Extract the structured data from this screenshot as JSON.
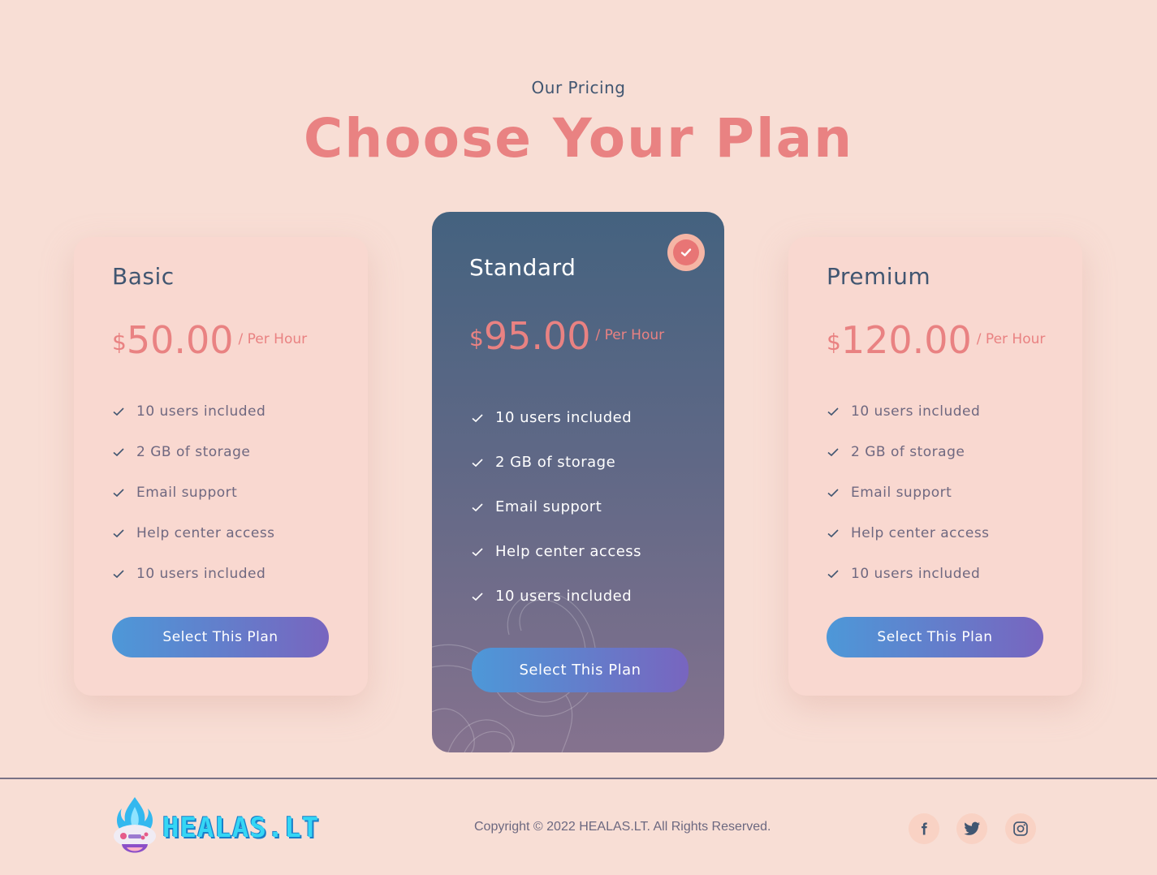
{
  "header": {
    "subtitle": "Our Pricing",
    "title": "Choose Your Plan"
  },
  "plans": [
    {
      "name": "Basic",
      "currency": "$",
      "amount": "50.00",
      "period": "/ Per Hour",
      "features": [
        "10 users included",
        "2 GB of storage",
        "Email support",
        "Help center access",
        "10 users included"
      ],
      "button_label": "Select This Plan"
    },
    {
      "name": "Standard",
      "currency": "$",
      "amount": "95.00",
      "period": "/ Per Hour",
      "features": [
        "10 users included",
        "2 GB of storage",
        "Email support",
        "Help center access",
        "10 users included"
      ],
      "button_label": "Select This Plan",
      "selected": true
    },
    {
      "name": "Premium",
      "currency": "$",
      "amount": "120.00",
      "period": "/ Per Hour",
      "features": [
        "10 users included",
        "2 GB of storage",
        "Email support",
        "Help center access",
        "10 users included"
      ],
      "button_label": "Select This Plan"
    }
  ],
  "footer": {
    "logo_text": "HEALAS.LT",
    "copyright": "Copyright © 2022 HEALAS.LT. All Rights Reserved.",
    "social_icons": [
      "facebook-icon",
      "twitter-icon",
      "instagram-icon"
    ]
  },
  "colors": {
    "background": "#f8ded5",
    "accent": "#e98282",
    "heading": "#415671",
    "button_start": "#4d98d8",
    "button_end": "#7865bf"
  }
}
